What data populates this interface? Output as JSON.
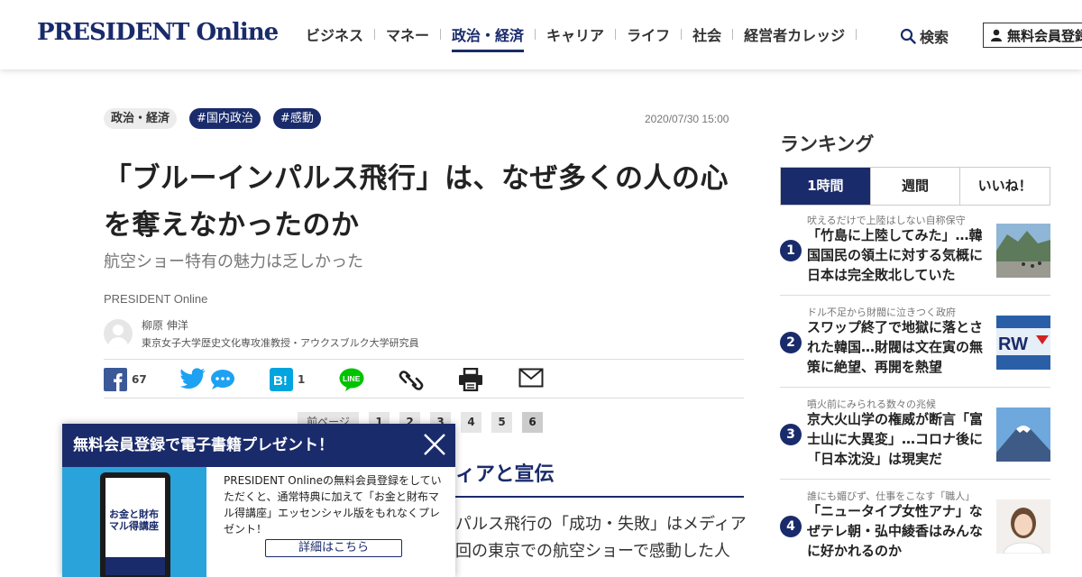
{
  "header": {
    "logo": "PRESIDENT Online",
    "nav": [
      "ビジネス",
      "マネー",
      "政治・経済",
      "キャリア",
      "ライフ",
      "社会",
      "経営者カレッジ"
    ],
    "nav_active": "政治・経済",
    "search_label": "検索",
    "signup_label": "無料会員登録"
  },
  "article": {
    "category": "政治・経済",
    "tags": [
      "#国内政治",
      "#感動"
    ],
    "date": "2020/07/30 15:00",
    "title": "「ブルーインパルス飛行」は、なぜ多くの人の心を奪えなかったのか",
    "subtitle": "航空ショー特有の魅力は乏しかった",
    "publisher": "PRESIDENT Online",
    "author_name": "柳原 伸洋",
    "author_role": "東京女子大学歴史文化専攻准教授・アウクスブルク大学研究員",
    "share": {
      "facebook_count": "67",
      "hatena_count": "1"
    },
    "pager": {
      "prev": "前ページ",
      "pages": [
        "1",
        "2",
        "3",
        "4",
        "5",
        "6"
      ],
      "current": "6"
    },
    "section_head": "ィアと宣伝",
    "body_lines": [
      "パルス飛行の「成功・失敗」はメディア",
      "回の東京での航空ショーで感動した人"
    ]
  },
  "popup": {
    "title": "無料会員登録で電子書籍プレゼント！",
    "text": "PRESIDENT Onlineの無料会員登録をしていただくと、通常特典に加えて「お金と財布マル得講座」エッセンシャル版をもれなくプレゼント！",
    "button": "詳細はこちら",
    "book_title": "お金と財布マル得講座"
  },
  "ranking": {
    "title": "ランキング",
    "tabs": [
      "1時間",
      "週間",
      "いいね！"
    ],
    "active_tab": "1時間",
    "items": [
      {
        "num": "1",
        "kicker": "吠えるだけで上陸はしない自称保守",
        "headline": "「竹島に上陸してみた」…韓国国民の領土に対する気概に日本は完全敗北していた"
      },
      {
        "num": "2",
        "kicker": "ドル不足から財閥に泣きつく政府",
        "headline": "スワップ終了で地獄に落とされた韓国…財閥は文在寅の無策に絶望、再開を熱望"
      },
      {
        "num": "3",
        "kicker": "噴火前にみられる数々の兆候",
        "headline": "京大火山学の権威が断言「富士山に大異変」…コロナ後に「日本沈没」は現実だ"
      },
      {
        "num": "4",
        "kicker": "誰にも媚びず、仕事をこなす「職人」",
        "headline": "「ニュータイプ女性アナ」なぜテレ朝・弘中綾香はみんなに好かれるのか"
      }
    ]
  },
  "colors": {
    "brand": "#1a2b6b",
    "facebook": "#3b5998",
    "twitter": "#1da1f2",
    "hatena": "#00a4de",
    "line": "#00c300"
  }
}
